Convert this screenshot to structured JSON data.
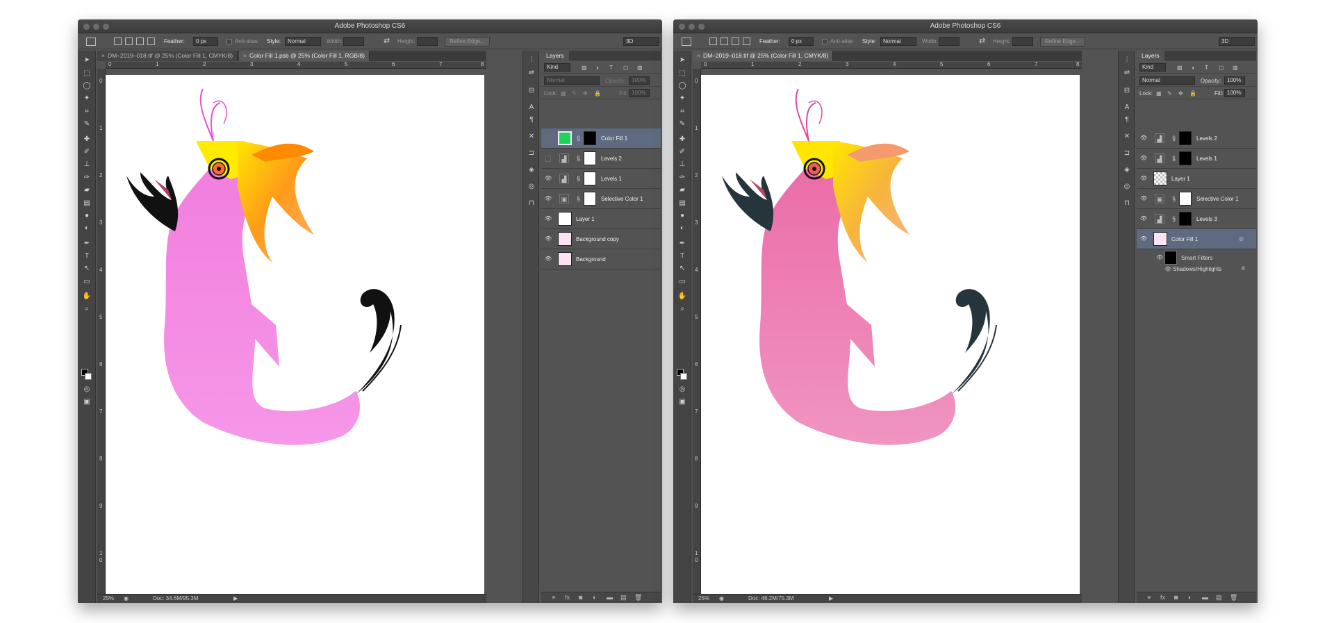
{
  "windows": [
    {
      "title": "Adobe Photoshop CS6",
      "options": {
        "feather_label": "Feather:",
        "feather_value": "0 px",
        "antialias_label": "Anti-alias",
        "style_label": "Style:",
        "style_value": "Normal",
        "width_label": "Width:",
        "height_label": "Height:",
        "refine_label": "Refine Edge...",
        "workspace": "3D"
      },
      "tabs": [
        "DM–2019–018.tif @ 25% (Color Fill 1, CMYK/8)",
        "Color Fill 1.psb @ 25% (Color Fill 1, RGB/8)"
      ],
      "ruler_top": [
        "0",
        "1",
        "2",
        "3",
        "4",
        "5",
        "6",
        "7",
        "8"
      ],
      "ruler_left": [
        "0",
        "1",
        "2",
        "3",
        "4",
        "5",
        "6",
        "7",
        "8",
        "9",
        "1",
        "0"
      ],
      "status": {
        "zoom": "25%",
        "doc": "Doc: 34.6M/95.3M"
      },
      "panel": {
        "title": "Layers",
        "kind": "Kind",
        "blend": "Normal",
        "opacity_label": "Opacity:",
        "opacity": "100%",
        "lock_label": "Lock:",
        "fill_label": "Fill:",
        "fill": "100%"
      },
      "layers": [
        {
          "name": "Color Fill 1",
          "visible": false,
          "selected": true
        },
        {
          "name": "Levels 2",
          "visible": false
        },
        {
          "name": "Levels 1",
          "visible": true
        },
        {
          "name": "Selective Color 1",
          "visible": true
        },
        {
          "name": "Layer 1",
          "visible": true
        },
        {
          "name": "Background copy",
          "visible": true
        },
        {
          "name": "Background",
          "visible": true
        }
      ],
      "fill_color": "#1fd25a"
    },
    {
      "title": "Adobe Photoshop CS6",
      "options": {
        "feather_label": "Feather:",
        "feather_value": "0 px",
        "antialias_label": "Anti-alias",
        "style_label": "Style:",
        "style_value": "Normal",
        "width_label": "Width:",
        "height_label": "Height:",
        "refine_label": "Refine Edge...",
        "workspace": "3D"
      },
      "tabs": [
        "DM–2019–018.tif @ 25% (Color Fill 1, CMYK/8)"
      ],
      "ruler_top": [
        "0",
        "1",
        "2",
        "3",
        "4",
        "5",
        "6",
        "7",
        "8"
      ],
      "ruler_left": [
        "0",
        "1",
        "2",
        "3",
        "4",
        "5",
        "6",
        "7",
        "8",
        "9",
        "1",
        "0"
      ],
      "status": {
        "zoom": "25%",
        "doc": "Doc: 46.2M/75.3M"
      },
      "panel": {
        "title": "Layers",
        "kind": "Kind",
        "blend": "Normal",
        "opacity_label": "Opacity:",
        "opacity": "100%",
        "lock_label": "Lock:",
        "fill_label": "Fill:",
        "fill": "100%"
      },
      "layers": [
        {
          "name": "Levels 2",
          "visible": true
        },
        {
          "name": "Levels 1",
          "visible": true
        },
        {
          "name": "Layer 1",
          "visible": true
        },
        {
          "name": "Selective Color 1",
          "visible": true
        },
        {
          "name": "Levels 3",
          "visible": true
        },
        {
          "name": "Color Fill 1",
          "visible": true,
          "selected": true
        }
      ],
      "smart_filters": "Smart Filters",
      "shadows_highlights": "Shadows/Highlights"
    }
  ]
}
